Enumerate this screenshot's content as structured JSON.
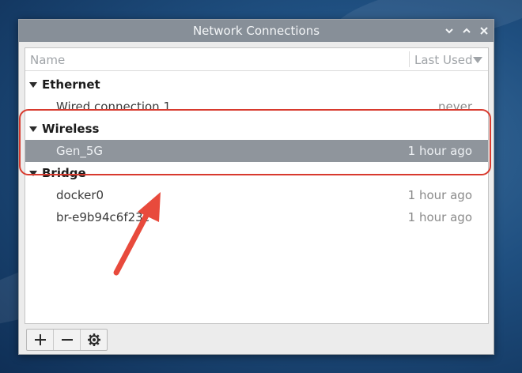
{
  "window": {
    "title": "Network Connections",
    "controls": [
      "minimize",
      "maximize",
      "close"
    ]
  },
  "table": {
    "columns": [
      "Name",
      "Last Used"
    ],
    "groups": [
      {
        "label": "Ethernet",
        "items": [
          {
            "name": "Wired connection 1",
            "last_used": "never"
          }
        ]
      },
      {
        "label": "Wireless",
        "items": [
          {
            "name": "Gen_5G",
            "last_used": "1 hour ago",
            "selected": true
          }
        ]
      },
      {
        "label": "Bridge",
        "items": [
          {
            "name": "docker0",
            "last_used": "1 hour ago"
          },
          {
            "name": "br-e9b94c6f23c",
            "last_used": "1 hour ago"
          }
        ]
      }
    ]
  },
  "toolbar": {
    "buttons": [
      "add-icon",
      "remove-icon",
      "gear-icon"
    ]
  },
  "annotation": {
    "color": "#d83a2e"
  },
  "colors": {
    "titlebar": "#878f98",
    "selected_row": "#8f959c"
  }
}
